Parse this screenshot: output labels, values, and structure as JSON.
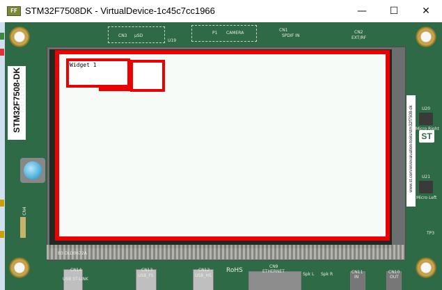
{
  "window": {
    "icon_text": "FF",
    "title": "STM32F7508DK - VirtualDevice-1c45c7cc1966",
    "controls": {
      "minimize": "—",
      "maximize": "☐",
      "close": "✕"
    }
  },
  "board": {
    "brand_label": "STM32F7508-DK",
    "board_id": "MB1191B",
    "url_text": "www.st.com/en/evaluation-tools/stm32f7508-dk",
    "silkscreen": {
      "cn3": "CN3",
      "usd": "µSD",
      "u19": "U19",
      "p1": "P1",
      "camera": "CAMERA",
      "cn1": "CN1",
      "spdif": "SPDIF IN",
      "cn2": "CN2",
      "ext_rf": "EXT/RF",
      "u20": "U20",
      "micro_right": "Micro Right",
      "u21": "U21",
      "micro_left": "Micro Left",
      "tp3": "TP3",
      "cn4": "CN4",
      "lcd_code": "B3 DLD0672A",
      "cn14": "CN14",
      "usb_stlink": "USB ST-LINK",
      "cn13": "CN13",
      "usb_fs": "USB_FS",
      "cn12": "CN12",
      "usb_hs": "USB_HS",
      "rohs": "RoHS",
      "cn9": "CN9",
      "ethernet": "ETHERNET",
      "spk_l": "Spk L",
      "spk_r": "Spk R",
      "cn11": "CN11",
      "in": "IN",
      "cn10": "CN10",
      "out": "OUT",
      "st_logo": "ST"
    }
  },
  "screen": {
    "widget1_label": "Widget 1"
  }
}
